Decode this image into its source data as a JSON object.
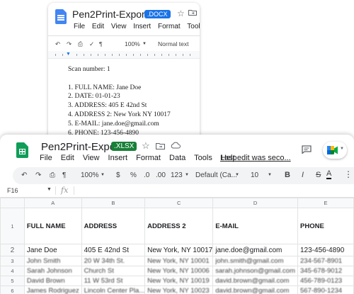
{
  "docs": {
    "title": "Pen2Print-Export",
    "badge": ".DOCX",
    "menu": [
      "File",
      "Edit",
      "View",
      "Insert",
      "Format",
      "Tools"
    ],
    "zoom": "100%",
    "style": "Normal text",
    "lines": [
      "Scan number: 1",
      "",
      "1. FULL NAME: Jane Doe",
      "2. DATE: 01-01-23",
      "3. ADDRESS: 405 E 42nd St",
      "4. ADDRESS 2: New York NY 10017",
      "5. E-MAIL: jane.doe@gmail.com",
      "6. PHONE: 123-456-4890"
    ]
  },
  "sheets": {
    "title": "Pen2Print-Export",
    "badge": ".XLSX",
    "menu": [
      "File",
      "Edit",
      "View",
      "Insert",
      "Format",
      "Data",
      "Tools",
      "Help"
    ],
    "last_edit": "Last edit was seco...",
    "toolbar": {
      "zoom": "100%",
      "currency": "$",
      "percent": "%",
      "decimal_less": ".0",
      "decimal_more": ".00",
      "number_format": "123",
      "font": "Default (Ca...",
      "font_size": "10",
      "bold": "B",
      "italic": "I",
      "strike": "S",
      "text_color": "A"
    },
    "cell_ref": "F16",
    "fx": "fx",
    "columns": [
      "A",
      "B",
      "C",
      "D",
      "E"
    ],
    "row_numbers": [
      "1",
      "2",
      "3",
      "4",
      "5",
      "6"
    ],
    "header_row": [
      "FULL NAME",
      "ADDRESS",
      "ADDRESS 2",
      "E-MAIL",
      "PHONE"
    ],
    "rows": [
      [
        "Jane Doe",
        "405 E 42nd St",
        "New York, NY 10017",
        "jane.doe@gmail.com",
        "123-456-4890"
      ],
      [
        "John Smith",
        "20 W 34th St.",
        "New York, NY 10001",
        "john.smith@gmail.com",
        "234-567-8901"
      ],
      [
        "Sarah Johnson",
        "Church St",
        "New York, NY 10006",
        "sarah.johnson@gmail.com",
        "345-678-9012"
      ],
      [
        "David Brown",
        "11 W 53rd St",
        "New York, NY 10019",
        "david.brown@gmail.com",
        "456-789-0123"
      ],
      [
        "James Rodriguez",
        "Lincoln Center Pla...",
        "New York, NY 10023",
        "david.brown@gmail.com",
        "567-890-1234"
      ]
    ]
  },
  "colors": {
    "docs_blue": "#4285f4",
    "docs_badge": "#1a73e8",
    "sheets_green": "#0f9d58",
    "sheets_badge": "#188038"
  }
}
